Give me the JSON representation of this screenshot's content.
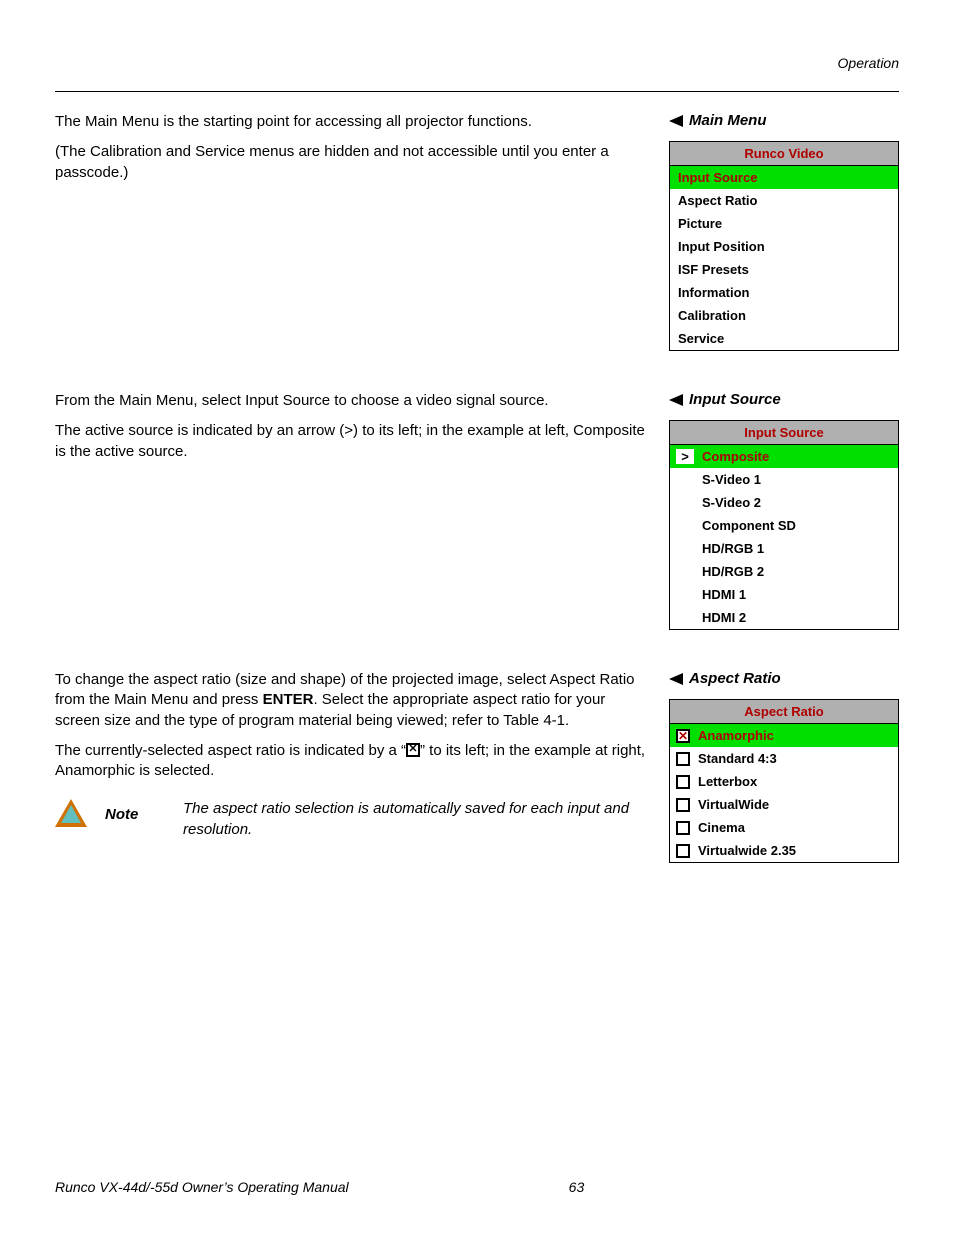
{
  "header": {
    "section": "Operation"
  },
  "main_menu": {
    "label": "Main Menu",
    "title": "Runco Video",
    "items": [
      "Input Source",
      "Aspect Ratio",
      "Picture",
      "Input Position",
      "ISF Presets",
      "Information",
      "Calibration",
      "Service"
    ],
    "active_index": 0,
    "paragraphs": {
      "p1": "The Main Menu is the starting point for accessing all projector functions.",
      "p2": "(The Calibration and Service menus are hidden and not accessible until you enter a passcode.)"
    }
  },
  "input_source": {
    "label": "Input Source",
    "title": "Input Source",
    "items": [
      "Composite",
      "S-Video 1",
      "S-Video 2",
      "Component SD",
      "HD/RGB 1",
      "HD/RGB 2",
      "HDMI 1",
      "HDMI 2"
    ],
    "active_index": 0,
    "indicator": ">",
    "paragraphs": {
      "p1": "From the Main Menu, select Input Source to choose a video signal source.",
      "p2": "The active source is indicated by an arrow (>) to its left; in the example at left, Composite is the active source."
    }
  },
  "aspect_ratio": {
    "label": "Aspect Ratio",
    "title": "Aspect Ratio",
    "items": [
      "Anamorphic",
      "Standard 4:3",
      "Letterbox",
      "VirtualWide",
      "Cinema",
      "Virtualwide 2.35"
    ],
    "active_index": 0,
    "check_mark": "✕",
    "paragraphs": {
      "p1a": "To change the aspect ratio (size and shape) of the projected image, select Aspect Ratio from the Main Menu and press ",
      "p1b": "ENTER",
      "p1c": ". Select the appropriate aspect ratio for your screen size and the type of program material being viewed; refer to Table 4-1.",
      "p2a": "The currently-selected aspect ratio is indicated by a “",
      "p2b": "” to its left; in the example at right, Anamorphic is selected."
    },
    "note": {
      "label": "Note",
      "text": "The aspect ratio selection is automatically saved for each input and resolution."
    }
  },
  "footer": {
    "title": "Runco VX-44d/-55d Owner’s Operating Manual",
    "page": "63"
  }
}
